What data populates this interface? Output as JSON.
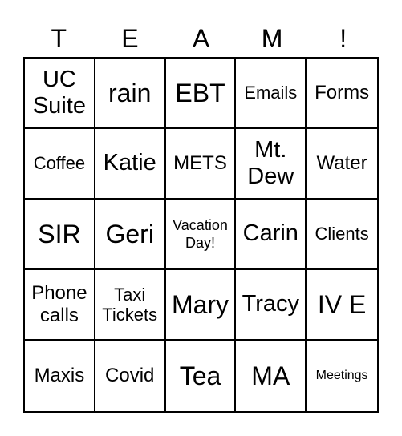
{
  "header": [
    "T",
    "E",
    "A",
    "M",
    "!"
  ],
  "cells": [
    {
      "text": "UC Suite",
      "size": "s-l"
    },
    {
      "text": "rain",
      "size": "s-xl"
    },
    {
      "text": "EBT",
      "size": "s-xl"
    },
    {
      "text": "Emails",
      "size": "s-s"
    },
    {
      "text": "Forms",
      "size": "s-m"
    },
    {
      "text": "Coffee",
      "size": "s-s"
    },
    {
      "text": "Katie",
      "size": "s-l"
    },
    {
      "text": "METS",
      "size": "s-m"
    },
    {
      "text": "Mt. Dew",
      "size": "s-l"
    },
    {
      "text": "Water",
      "size": "s-m"
    },
    {
      "text": "SIR",
      "size": "s-xl"
    },
    {
      "text": "Geri",
      "size": "s-xl"
    },
    {
      "text": "Vacation Day!",
      "size": "s-xs"
    },
    {
      "text": "Carin",
      "size": "s-l"
    },
    {
      "text": "Clients",
      "size": "s-s"
    },
    {
      "text": "Phone calls",
      "size": "s-m"
    },
    {
      "text": "Taxi Tickets",
      "size": "s-s"
    },
    {
      "text": "Mary",
      "size": "s-xl"
    },
    {
      "text": "Tracy",
      "size": "s-l"
    },
    {
      "text": "IV E",
      "size": "s-xl"
    },
    {
      "text": "Maxis",
      "size": "s-m"
    },
    {
      "text": "Covid",
      "size": "s-m"
    },
    {
      "text": "Tea",
      "size": "s-xl"
    },
    {
      "text": "MA",
      "size": "s-xl"
    },
    {
      "text": "Meetings",
      "size": "s-xxs"
    }
  ]
}
